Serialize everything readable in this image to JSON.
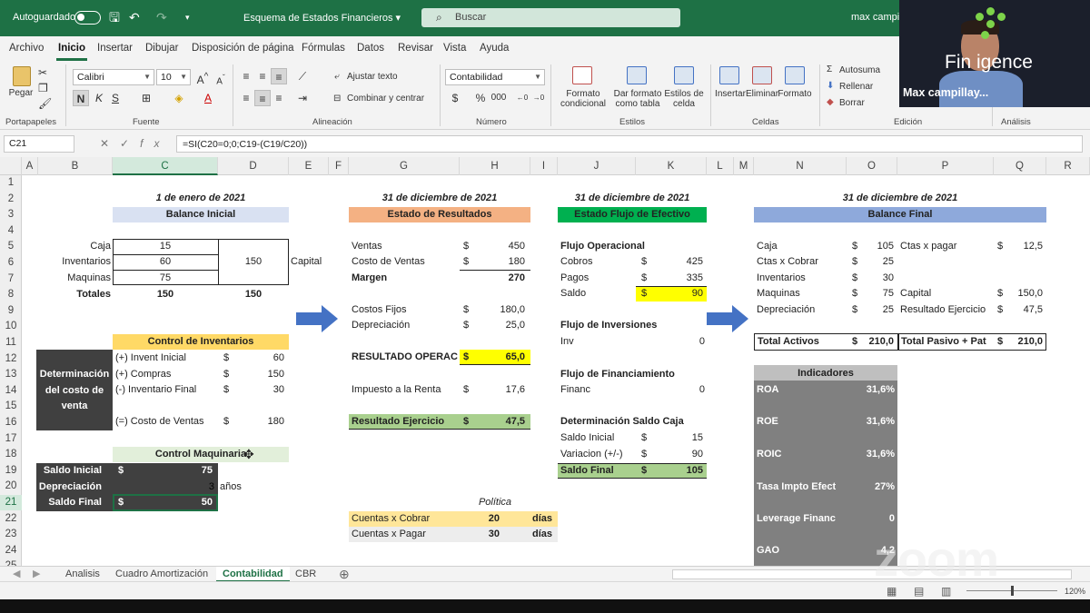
{
  "titlebar": {
    "autosave": "Autoguardado",
    "doc_title": "Esquema de Estados Financieros ▾",
    "search_placeholder": "Buscar",
    "user": "max campillay"
  },
  "ribbon_tabs": [
    "Archivo",
    "Inicio",
    "Insertar",
    "Dibujar",
    "Disposición de página",
    "Fórmulas",
    "Datos",
    "Revisar",
    "Vista",
    "Ayuda"
  ],
  "ribbon": {
    "paste": "Pegar",
    "font_name": "Calibri",
    "font_size": "10",
    "wrap": "Ajustar texto",
    "merge": "Combinar y centrar",
    "number_format": "Contabilidad",
    "cond_format": [
      "Formato",
      "condicional"
    ],
    "table_format": [
      "Dar formato",
      "como tabla"
    ],
    "cell_styles": [
      "Estilos de",
      "celda"
    ],
    "insert": "Insertar",
    "delete": "Eliminar",
    "format": "Formato",
    "autosum": "Autosuma",
    "fill": "Rellenar",
    "clear": "Borrar",
    "groups": [
      "Portapapeles",
      "Fuente",
      "Alineación",
      "Número",
      "Estilos",
      "Celdas",
      "Edición",
      "Análisis"
    ]
  },
  "formula_bar": {
    "name_box": "C21",
    "formula": "=SI(C20=0;0;C19-(C19/C20))"
  },
  "columns": [
    "A",
    "B",
    "C",
    "D",
    "E",
    "F",
    "G",
    "H",
    "I",
    "J",
    "K",
    "L",
    "M",
    "N",
    "O",
    "P",
    "Q",
    "R"
  ],
  "rows": [
    "1",
    "2",
    "3",
    "4",
    "5",
    "6",
    "7",
    "8",
    "9",
    "10",
    "11",
    "12",
    "13",
    "14",
    "15",
    "16",
    "17",
    "18",
    "19",
    "20",
    "21",
    "22",
    "23",
    "24",
    "25"
  ],
  "balance_inicial": {
    "date": "1 de enero de 2021",
    "title": "Balance Inicial",
    "caja_label": "Caja",
    "caja": "15",
    "inv_label": "Inventarios",
    "inv": "60",
    "maq_label": "Maquinas",
    "maq": "75",
    "capital_val": "150",
    "capital_label": "Capital",
    "totales_label": "Totales",
    "total_left": "150",
    "total_right": "150"
  },
  "control_inventarios": {
    "title": "Control de Inventarios",
    "side_label": [
      "Determinación",
      "del costo de",
      "venta"
    ],
    "rows": [
      {
        "label": "(+) Invent Inicial",
        "cur": "$",
        "val": "60"
      },
      {
        "label": "(+) Compras",
        "cur": "$",
        "val": "150"
      },
      {
        "label": "(-) Inventario Final",
        "cur": "$",
        "val": "30"
      },
      {
        "label": "(=) Costo de Ventas",
        "cur": "$",
        "val": "180"
      }
    ]
  },
  "control_maquinaria": {
    "title": "Control Maquinaria",
    "saldo_inicial_label": "Saldo Inicial",
    "saldo_inicial_cur": "$",
    "saldo_inicial": "75",
    "depreciacion_label": "Depreciación",
    "depreciacion": "3",
    "anos": "años",
    "saldo_final_label": "Saldo Final",
    "saldo_final_cur": "$",
    "saldo_final": "50"
  },
  "estado_resultados": {
    "date": "31 de diciembre de 2021",
    "title": "Estado de Resultados",
    "ventas_label": "Ventas",
    "ventas": "450",
    "costo_label": "Costo de Ventas",
    "costo": "180",
    "margen_label": "Margen",
    "margen": "270",
    "fijos_label": "Costos Fijos",
    "fijos": "180,0",
    "dep_label": "Depreciación",
    "dep": "25,0",
    "operac_label": "RESULTADO OPERAC",
    "operac": "65,0",
    "impuesto_label": "Impuesto a la Renta",
    "impuesto": "17,6",
    "ejercicio_label": "Resultado Ejercicio",
    "ejercicio": "47,5",
    "cur": "$"
  },
  "politica": {
    "title": "Política",
    "cxc_label": "Cuentas x Cobrar",
    "cxc": "20",
    "cxc_unit": "días",
    "cxp_label": "Cuentas x Pagar",
    "cxp": "30",
    "cxp_unit": "días"
  },
  "flujo_efectivo": {
    "date": "31 de diciembre de 2021",
    "title": "Estado Flujo de Efectivo",
    "operacional": "Flujo Operacional",
    "cobros_label": "Cobros",
    "cobros": "425",
    "pagos_label": "Pagos",
    "pagos": "335",
    "saldo_label": "Saldo",
    "saldo": "90",
    "inversiones": "Flujo de Inversiones",
    "inv_label": "Inv",
    "inv": "0",
    "financiamiento": "Flujo de Financiamiento",
    "financ_label": "Financ",
    "financ": "0",
    "det_caja": "Determinación Saldo Caja",
    "saldo_ini_label": "Saldo Inicial",
    "saldo_ini": "15",
    "variacion_label": "Variacion (+/-)",
    "variacion": "90",
    "saldo_fin_label": "Saldo Final",
    "saldo_fin": "105",
    "cur": "$"
  },
  "balance_final": {
    "date": "31 de diciembre de 2021",
    "title": "Balance Final",
    "caja_label": "Caja",
    "caja": "105",
    "cxc_label": "Ctas x Cobrar",
    "cxc": "25",
    "inv_label": "Inventarios",
    "inv": "30",
    "maq_label": "Maquinas",
    "maq": "75",
    "dep_label": "Depreciación",
    "dep": "25",
    "cxp_label": "Ctas x pagar",
    "cxp": "12,5",
    "capital_label": "Capital",
    "capital": "150,0",
    "res_label": "Resultado Ejercicio",
    "res": "47,5",
    "total_activos_label": "Total Activos",
    "total_activos": "210,0",
    "total_pasivo_label": "Total Pasivo + Pat",
    "total_pasivo": "210,0",
    "cur": "$"
  },
  "indicadores": {
    "title": "Indicadores",
    "rows": [
      {
        "label": "ROA",
        "val": "31,6%"
      },
      {
        "label": "ROE",
        "val": "31,6%"
      },
      {
        "label": "ROIC",
        "val": "31,6%"
      },
      {
        "label": "Tasa Impto Efect",
        "val": "27%"
      },
      {
        "label": "Leverage Financ",
        "val": "0"
      },
      {
        "label": "GAO",
        "val": "4,2"
      }
    ]
  },
  "sheet_tabs": [
    "Analisis",
    "Cuadro Amortización",
    "Contabilidad",
    "CBR"
  ],
  "status": {
    "zoom": "120%"
  },
  "video": {
    "name": "Max campillay...",
    "brand": "Fin  igence"
  },
  "watermark": "zoom",
  "colors": {
    "excel_green": "#1e7145",
    "header_blue_light": "#d9e1f2",
    "header_orange": "#f4b183",
    "header_green": "#00b050",
    "header_blue": "#8ea9db",
    "yellow": "#ffff00",
    "light_yellow": "#ffe699",
    "light_green": "#a9d08e",
    "dark_gray": "#404040",
    "mid_gray": "#808080",
    "arrow_blue": "#4472c4"
  }
}
